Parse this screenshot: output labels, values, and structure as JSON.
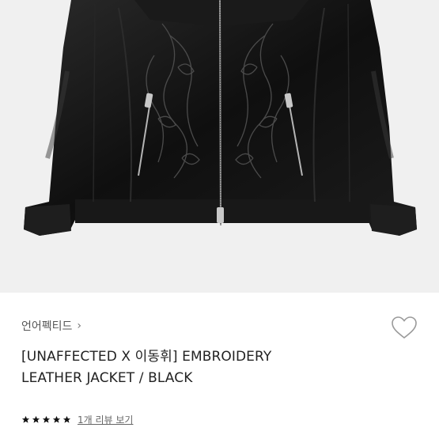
{
  "product": {
    "brand": "언어펙티드",
    "title_line1": "[UNAFFECTED X 이동휘] EMBROIDERY",
    "title_line2": "LEATHER JACKET / BLACK",
    "rating_stars": 5,
    "review_link": "1개 리뷰 보기"
  },
  "icons": {
    "brand_chevron": "chevron-right-icon",
    "like": "heart-outline-icon",
    "star": "star-icon"
  },
  "colors": {
    "image_bg": "#f0f0f0",
    "jacket": "#141414",
    "star": "#111111"
  }
}
